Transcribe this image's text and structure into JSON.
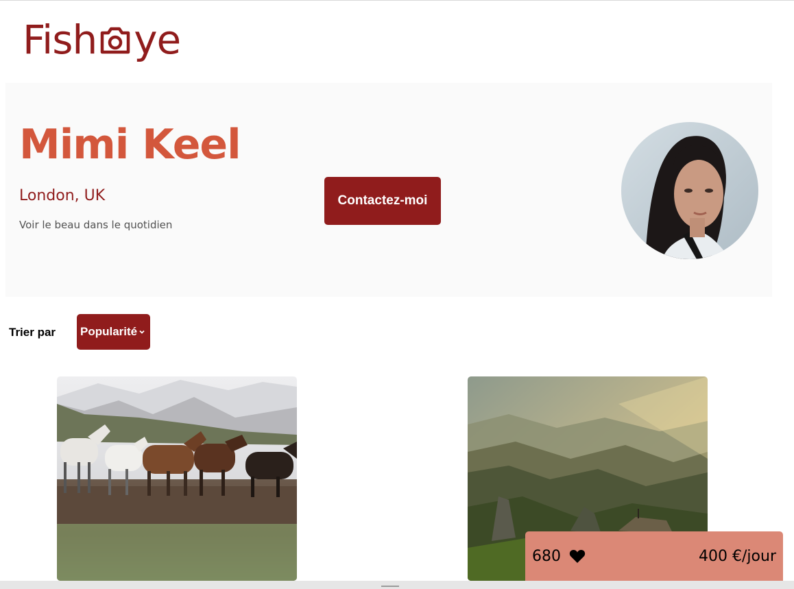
{
  "logo": {
    "text_before": "Fish",
    "icon": "camera-icon",
    "text_after": "ye",
    "color": "#901C1C"
  },
  "photographer": {
    "name": "Mimi Keel",
    "location": "London, UK",
    "tagline": "Voir le beau dans le quotidien",
    "avatar_icon": "portrait-photo"
  },
  "contact": {
    "label": "Contactez-moi"
  },
  "sort": {
    "label": "Trier par",
    "selected": "Popularité"
  },
  "media": [
    {
      "subject": "horses-photo"
    },
    {
      "subject": "mountain-landscape-photo"
    }
  ],
  "stats": {
    "likes": "680",
    "price": "400 €/jour"
  },
  "colors": {
    "primary": "#901C1C",
    "secondary": "#D3573C",
    "stats_bg": "#DB8876",
    "header_bg": "#FAFAFA"
  }
}
